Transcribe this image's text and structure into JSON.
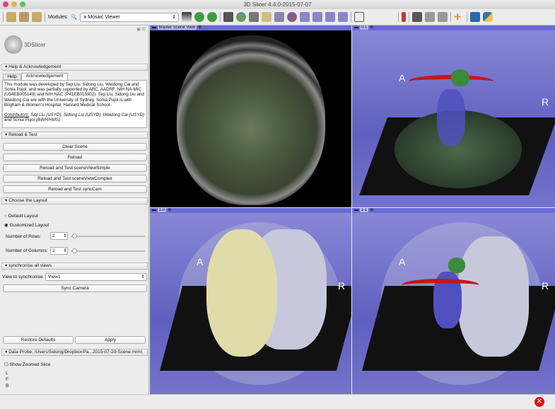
{
  "window": {
    "title": "3D Slicer 4.4.0-2015-07-07"
  },
  "toolbar": {
    "modules_label": "Modules:",
    "module_selected": "Mosaic Viewer"
  },
  "logo": {
    "text": "3DSlicer"
  },
  "help": {
    "header": "Help & Acknowledgement",
    "tabs": [
      "Help",
      "Acknowledgement"
    ],
    "text": "This module was developed by Siqi Liu, Sidong Liu, Weidong Cai and Sonia Pujol, and was partially supported by ARC, AADRF, NIH NA-MIC (U54EB005149) and NIH NAC (P41EB015902). Siqi Liu, Sidong Liu and Weidong Cai are with the University of Sydney. Sonia Pujol is with Brigham & Women's Hospital, Harvard Medical School.",
    "contributors_label": "Contributors:",
    "contributors": " Siqi Liu (USYD), Sidong Liu (USYD), Weidong Cai (USYD) and Sonia Pujol (BWH/HMS)"
  },
  "reload": {
    "header": "Reload & Test",
    "buttons": [
      "Clear Scene",
      "Reload",
      "Reload and Test sceneViewSimple",
      "Reload and Test sceneViewComplex",
      "Reload and Test syncCam"
    ]
  },
  "layout": {
    "header": "Choose the Layout",
    "radio_default": "Default Layout",
    "radio_custom": "Customized Layout",
    "rows_label": "Number of Rows:",
    "rows_value": "2",
    "cols_label": "Number of Columns:",
    "cols_value": "2"
  },
  "sync": {
    "header": "synchronise all views",
    "view_label": "View to synchronise",
    "view_value": "View1",
    "button": "Sync Camera"
  },
  "footer_buttons": {
    "restore": "Restore Defaults",
    "apply": "Apply"
  },
  "probe": {
    "header": "Data Probe: /Users/Sidong/Dropbox/Pa...2015-07-20-Scene.mrml",
    "checkbox": "Show Zoomed Slice",
    "lines": [
      "L",
      "F",
      "B"
    ]
  },
  "views": {
    "v00": "Master Scene View",
    "v01": "0-1",
    "v10": "1-0",
    "v11": "1-1",
    "orient_a": "A",
    "orient_r": "R"
  }
}
